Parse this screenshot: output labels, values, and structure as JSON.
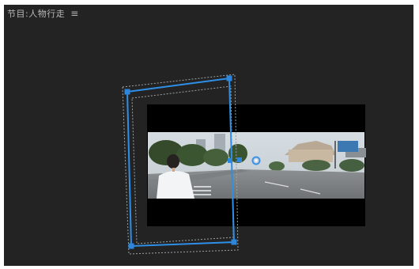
{
  "panel": {
    "title": "节目:人物行走",
    "menu_icon": "hamburger-menu-icon"
  },
  "colors": {
    "panel_bg": "#232323",
    "letterbox": "#000000",
    "transform_blue": "#2f8fe6",
    "handle_blue": "#2b86dc",
    "anchor_ring": "#3a92ea"
  },
  "icons": {
    "anchor_point": "anchor-point-icon",
    "corner_handle": "corner-handle-icon"
  }
}
